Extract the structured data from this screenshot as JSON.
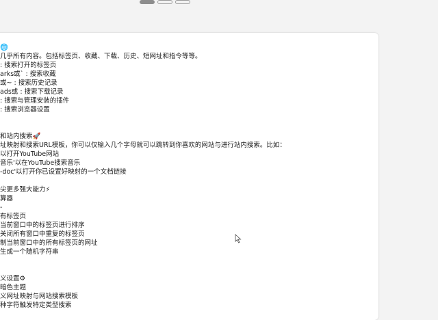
{
  "tabs": [
    {
      "active": true
    },
    {
      "active": false
    },
    {
      "active": false
    }
  ],
  "lines": [
    {
      "type": "text",
      "text": "🌐"
    },
    {
      "type": "text",
      "text": "几乎所有内容。包括标签页、收藏、下载、历史、短网址和指令等等。"
    },
    {
      "type": "text",
      "text": ": 搜索打开的标签页"
    },
    {
      "type": "text",
      "text": "arks或` : 搜索收藏"
    },
    {
      "type": "text",
      "text": "或~ : 搜索历史记录"
    },
    {
      "type": "text",
      "text": "ads或 : 搜索下载记录"
    },
    {
      "type": "text",
      "text": ": 搜索与管理安装的插件"
    },
    {
      "type": "text",
      "text": ": 搜索浏览器设置"
    },
    {
      "type": "gap"
    },
    {
      "type": "gap"
    },
    {
      "type": "text",
      "text": "和站内搜索🚀"
    },
    {
      "type": "text",
      "text": "址映射和搜索URL模板，你可以仅输入几个字母就可以跳转到你喜欢的网站与进行站内搜索。比如："
    },
    {
      "type": "text",
      "text": "以打开YouTube网站"
    },
    {
      "type": "text",
      "text": "音乐'以在YouTube搜索音乐"
    },
    {
      "type": "text",
      "text": "-doc'以打开你已设置好映射的一个文档链接"
    },
    {
      "type": "gap"
    },
    {
      "type": "text",
      "text": "尖更多强大能力⚡"
    },
    {
      "type": "text",
      "text": "算器"
    },
    {
      "type": "text",
      "text": "-"
    },
    {
      "type": "text",
      "text": "有标签页"
    },
    {
      "type": "text",
      "text": "当前窗口中的标签页进行排序"
    },
    {
      "type": "text",
      "text": "关闭所有窗口中重复的标签页"
    },
    {
      "type": "text",
      "text": "制当前窗口中的所有标签页的网址"
    },
    {
      "type": "text",
      "text": "生成一个随机字符串"
    },
    {
      "type": "gap"
    },
    {
      "type": "gap"
    },
    {
      "type": "text",
      "text": "义设置⚙"
    },
    {
      "type": "text",
      "text": "暗色主题"
    },
    {
      "type": "text",
      "text": "义网址映射与网站搜索模板"
    },
    {
      "type": "text",
      "text": "种字符触发特定类型搜索"
    }
  ]
}
